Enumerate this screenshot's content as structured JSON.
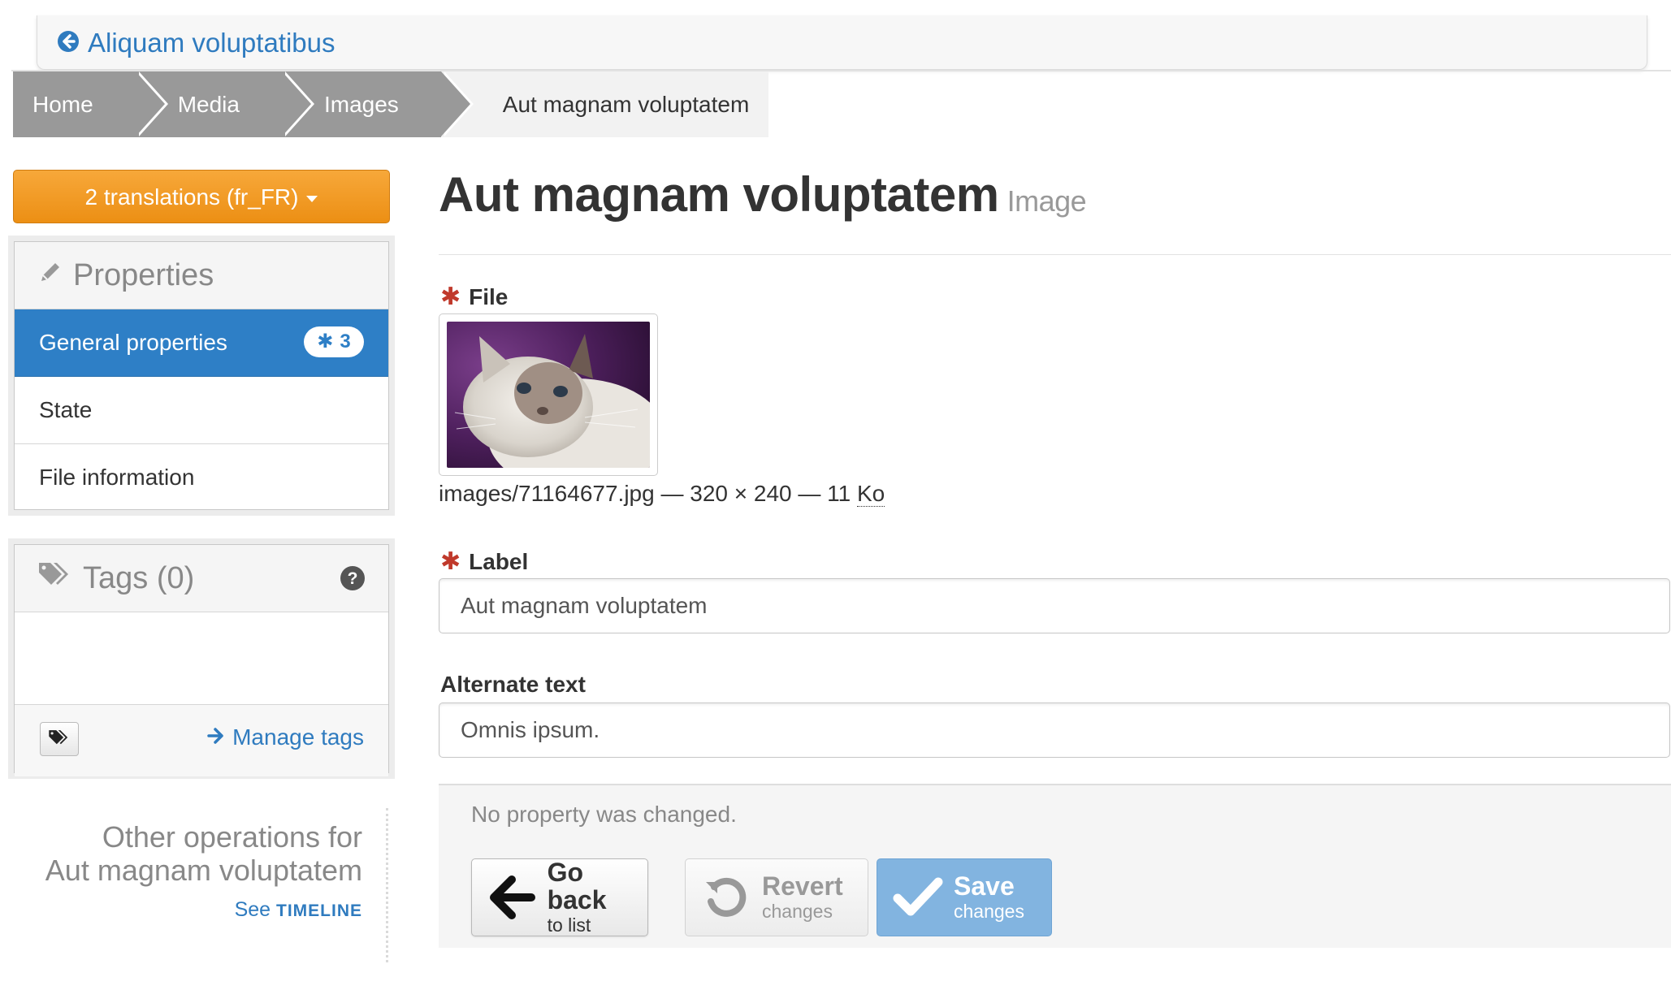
{
  "topbar": {
    "back_label": "Aliquam voluptatibus"
  },
  "breadcrumb": {
    "items": [
      "Home",
      "Media",
      "Images"
    ],
    "current": "Aut magnam voluptatem"
  },
  "translations": {
    "label": "2 translations (fr_FR)"
  },
  "properties_panel": {
    "title": "Properties",
    "items": [
      {
        "label": "General properties",
        "badge": "3",
        "active": true
      },
      {
        "label": "State"
      },
      {
        "label": "File information"
      }
    ]
  },
  "tags_panel": {
    "title": "Tags (0)",
    "manage_label": "Manage tags"
  },
  "other_operations": {
    "line1": "Other operations for",
    "line2": "Aut magnam voluptatem",
    "link_prefix": "See",
    "link_strong": "TIMELINE"
  },
  "page": {
    "title": "Aut magnam voluptatem",
    "subtitle": "Image"
  },
  "form": {
    "file_label": "File",
    "file_meta": "images/71164677.jpg — 320 × 240 — 11",
    "file_size_unit": "Ko",
    "label_label": "Label",
    "label_value": "Aut magnam voluptatem",
    "alt_label": "Alternate text",
    "alt_value": "Omnis ipsum."
  },
  "footer": {
    "status": "No property was changed.",
    "go_back": {
      "main": "Go back",
      "sub": "to list"
    },
    "revert": {
      "main": "Revert",
      "sub": "changes"
    },
    "save": {
      "main": "Save",
      "sub": "changes"
    }
  },
  "colors": {
    "accent_blue": "#2e7fc6",
    "link_blue": "#2f7bbf",
    "orange": "#ec8f14",
    "required_red": "#c0392b",
    "save_blue": "#82b4e0"
  }
}
